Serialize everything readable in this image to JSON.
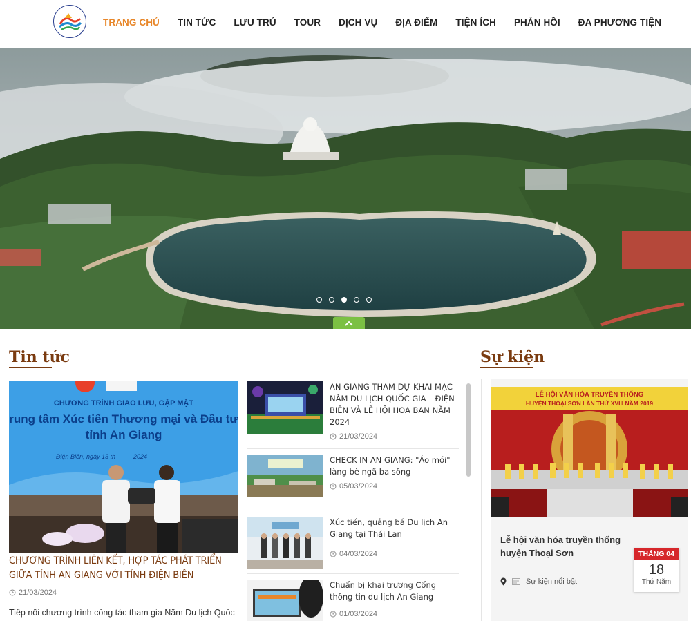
{
  "nav": {
    "items": [
      {
        "label": "TRANG CHỦ"
      },
      {
        "label": "TIN TỨC"
      },
      {
        "label": "LƯU TRÚ"
      },
      {
        "label": "TOUR"
      },
      {
        "label": "DỊCH VỤ"
      },
      {
        "label": "ĐỊA ĐIỂM"
      },
      {
        "label": "TIỆN ÍCH"
      },
      {
        "label": "PHẢN HỒI"
      },
      {
        "label": "ĐA PHƯƠNG TIỆN"
      }
    ],
    "active_index": 0,
    "active_color": "#e8872a"
  },
  "hero": {
    "slide_count": 5,
    "active_slide": 3
  },
  "news": {
    "title": "Tin tức",
    "featured": {
      "image_heading_1": "CHƯƠNG TRÌNH GIAO LƯU, GẶP MẶT",
      "image_heading_2": "rung tâm Xúc tiến Thương mại và Đầu tư",
      "image_heading_3": "tỉnh An Giang",
      "image_caption": "Điện Biên, ngày 13 th",
      "image_caption_2": "2024",
      "title": "CHƯƠNG TRÌNH LIÊN KẾT, HỢP TÁC PHÁT TRIỂN GIỮA TỈNH AN GIANG VỚI TỈNH ĐIỆN BIÊN",
      "date": "21/03/2024",
      "excerpt": "Tiếp nối chương trình công tác tham gia Năm Du lịch Quốc"
    },
    "items": [
      {
        "title": "AN GIANG THAM DỰ KHAI MẠC NĂM DU LỊCH QUỐC GIA – ĐIỆN BIÊN VÀ LỄ HỘI HOA BAN NĂM 2024",
        "date": "21/03/2024"
      },
      {
        "title": "CHECK IN AN GIANG: \"Áo mới\" làng bè ngã ba sông",
        "date": "05/03/2024"
      },
      {
        "title": "Xúc tiến, quảng bá Du lịch An Giang tại Thái Lan",
        "date": "04/03/2024"
      },
      {
        "title": "Chuẩn bị khai trương Cổng thông tin du lịch An Giang",
        "date": "01/03/2024"
      }
    ]
  },
  "events": {
    "title": "Sự kiện",
    "item": {
      "banner_line_1": "LỄ HỘI VĂN HÓA TRUYỀN THỐNG",
      "banner_line_2": "HUYỆN THOẠI SƠN LẦN THỨ XVIII NĂM 2019",
      "title": "Lễ hội văn hóa truyền thống huyện Thoại Sơn",
      "category": "Sự kiện nổi bật",
      "month": "THÁNG 04",
      "day": "18",
      "weekday": "Thứ Năm"
    }
  },
  "colors": {
    "heading": "#7a3b10",
    "accent_green": "#7bc043",
    "calendar_red": "#d6272b"
  }
}
